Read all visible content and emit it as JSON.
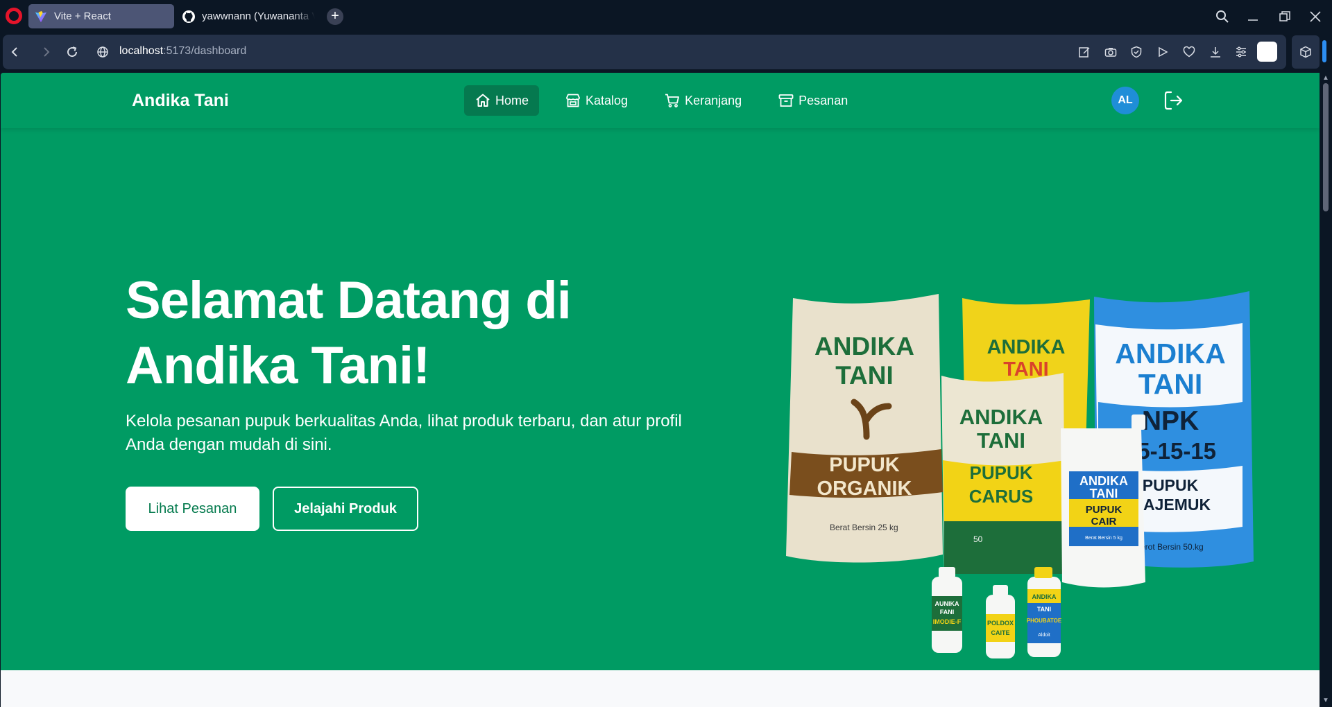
{
  "browser": {
    "tabs": [
      {
        "title": "Vite + React",
        "active": true,
        "icon": "vite-icon"
      },
      {
        "title": "yawwnann (Yuwananta Val",
        "active": false,
        "icon": "github-icon"
      }
    ],
    "new_tab_label": "+",
    "url_host": "localhost",
    "url_path": ":5173/dashboard"
  },
  "site": {
    "brand": "Andika Tani",
    "nav": [
      {
        "label": "Home",
        "icon": "home-icon",
        "active": true
      },
      {
        "label": "Katalog",
        "icon": "store-icon",
        "active": false
      },
      {
        "label": "Keranjang",
        "icon": "cart-icon",
        "active": false
      },
      {
        "label": "Pesanan",
        "icon": "archive-icon",
        "active": false
      }
    ],
    "avatar_initials": "AL"
  },
  "hero": {
    "title_line1": "Selamat Datang di",
    "title_line2": "Andika Tani!",
    "subtitle": "Kelola pesanan pupuk berkualitas Anda, lihat produk terbaru, dan atur profil Anda dengan mudah di sini.",
    "primary_button": "Lihat Pesanan",
    "secondary_button": "Jelajahi Produk"
  },
  "products": {
    "bag_organik": {
      "brand_line1": "ANDIKA",
      "brand_line2": "TANI",
      "name_line1": "PUPUK",
      "name_line2": "ORGANIK",
      "weight": "Berat Bersin 25 kg"
    },
    "bag_yellow_back": {
      "brand_line1": "ANDIKA",
      "brand_line2": "TANI"
    },
    "bag_carus": {
      "brand_line1": "ANDIKA",
      "brand_line2": "TANI",
      "name_line1": "PUPUK",
      "name_line2": "CARUS",
      "weight": "50"
    },
    "bag_npk": {
      "brand_line1": "ANDIKA",
      "brand_line2": "TANI",
      "name_line1": "NPK",
      "name_line2": "15-15-15",
      "name_line3": "PUPUK",
      "name_line4": "MAJEMUK",
      "weight": "Berot Bersin 50.kg"
    },
    "jerrycan": {
      "brand_line1": "ANDIKA",
      "brand_line2": "TANI",
      "name_line1": "PUPUK",
      "name_line2": "CAIR",
      "weight": "Berat Bersin 5 kg"
    },
    "bottle1": {
      "line1": "AUNIKA",
      "line2": "FANI",
      "line3": "IMODIE-F"
    },
    "bottle2": {
      "line1": "POLDOX",
      "line2": "CAITE"
    },
    "bottle3": {
      "line1": "ANDIKA",
      "line2": "TANI",
      "line3": "PHOUBATOE",
      "line4": "Aldoit"
    }
  },
  "colors": {
    "primary": "#009b63",
    "nav_active": "#05794f",
    "avatar": "#1f8ed8"
  }
}
